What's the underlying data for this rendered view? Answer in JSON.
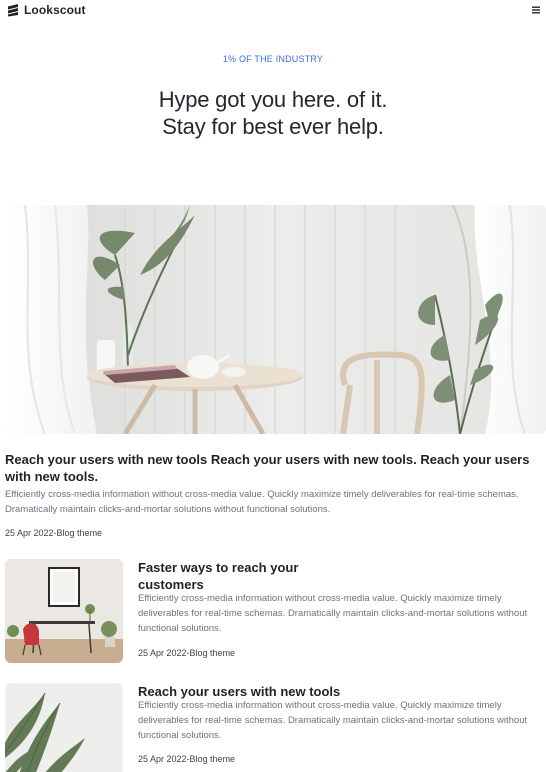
{
  "brand": {
    "name": "Lookscout"
  },
  "hero": {
    "eyebrow": "1% OF THE INDUSTRY",
    "headline_line1": "Hype got you here. of it.",
    "headline_line2": "Stay for best ever help."
  },
  "featured": {
    "title": "Reach your users with new tools Reach your users with new tools. Reach your users with new tools.",
    "description": "Efficiently cross-media information without cross-media value. Quickly maximize timely deliverables for real-time schemas. Dramatically maintain clicks-and-mortar solutions without functional solutions.",
    "meta": "25 Apr 2022-Blog theme"
  },
  "posts": [
    {
      "title": "Faster ways to reach your customers",
      "description": "Efficiently cross-media information without cross-media value. Quickly maximize timely deliverables for real-time schemas. Dramatically maintain clicks-and-mortar solutions without functional solutions.",
      "meta": "25 Apr 2022-Blog theme"
    },
    {
      "title": "Reach your users with new tools",
      "description": "Efficiently cross-media information without cross-media value. Quickly maximize timely deliverables for real-time schemas. Dramatically maintain clicks-and-mortar solutions without functional solutions.",
      "meta": "25 Apr 2022-Blog theme"
    }
  ],
  "icons": {
    "logo": "stacked-layers-icon",
    "menu": "hamburger-menu-icon"
  },
  "colors": {
    "accent": "#3c6fd8",
    "text": "#1f2328",
    "muted": "#6b7280"
  }
}
